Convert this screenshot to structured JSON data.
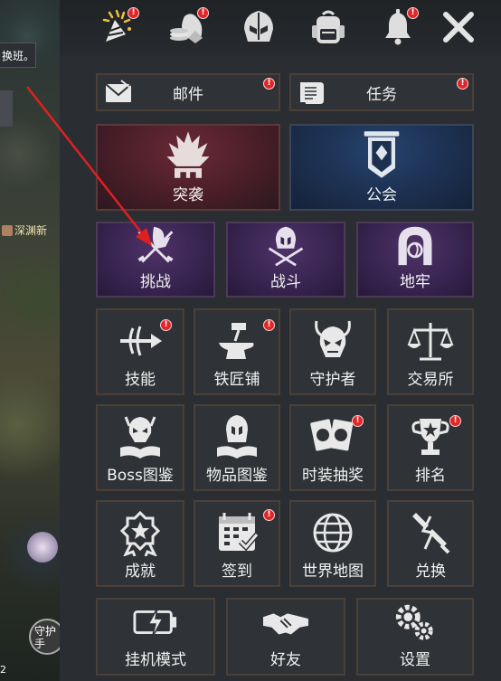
{
  "scene": {
    "tooltip": "换班。",
    "player_name": "深渊新",
    "corner_number": "2",
    "guard_label": "守护手"
  },
  "topbar": {
    "icons": [
      {
        "name": "celebration-icon",
        "badge": "!"
      },
      {
        "name": "treasure-icon",
        "badge": "!"
      },
      {
        "name": "helmet-icon",
        "badge": ""
      },
      {
        "name": "backpack-icon",
        "badge": ""
      },
      {
        "name": "bell-icon",
        "badge": "!"
      },
      {
        "name": "close-icon",
        "badge": ""
      }
    ]
  },
  "menu": {
    "mail": {
      "label": "邮件",
      "badge": "!"
    },
    "quest": {
      "label": "任务",
      "badge": "!"
    },
    "raid": {
      "label": "突袭"
    },
    "guild": {
      "label": "公会"
    },
    "challenge": {
      "label": "挑战"
    },
    "battle": {
      "label": "战斗"
    },
    "dungeon": {
      "label": "地牢"
    },
    "skills": {
      "label": "技能",
      "badge": "!"
    },
    "blacksmith": {
      "label": "铁匠铺",
      "badge": "!"
    },
    "guardian": {
      "label": "守护者"
    },
    "exchange_house": {
      "label": "交易所"
    },
    "boss_codex": {
      "label": "Boss图鉴"
    },
    "item_codex": {
      "label": "物品图鉴"
    },
    "costume_lottery": {
      "label": "时装抽奖",
      "badge": "!"
    },
    "ranking": {
      "label": "排名",
      "badge": "!"
    },
    "achievements": {
      "label": "成就"
    },
    "checkin": {
      "label": "签到",
      "badge": "!"
    },
    "world_map": {
      "label": "世界地图"
    },
    "redeem": {
      "label": "兑换"
    },
    "idle_mode": {
      "label": "挂机模式"
    },
    "friends": {
      "label": "好友"
    },
    "settings": {
      "label": "设置"
    }
  },
  "colors": {
    "badge": "#e0262a",
    "arrow": "#e02020",
    "raid_bg": "#4a1e28",
    "guild_bg": "#1c3050",
    "purple_bg": "#392552"
  }
}
